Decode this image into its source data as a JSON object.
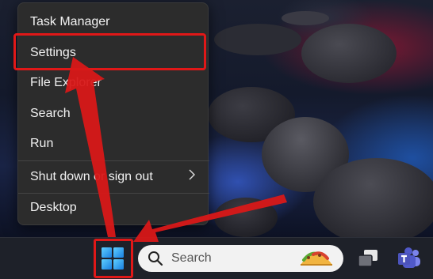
{
  "menu": {
    "items": [
      {
        "label": "Task Manager"
      },
      {
        "label": "Settings"
      },
      {
        "label": "File Explorer"
      },
      {
        "label": "Search"
      },
      {
        "label": "Run"
      },
      {
        "label": "Shut down or sign out",
        "has_submenu": true
      },
      {
        "label": "Desktop"
      }
    ],
    "submenu_icon": "chevron-right-icon",
    "highlighted_item": "Settings"
  },
  "taskbar": {
    "search_placeholder": "Search",
    "start_icon": "windows-logo-icon",
    "icons": [
      "search-icon",
      "taco-widget-icon",
      "task-view-icon",
      "teams-icon"
    ]
  },
  "annotation": {
    "color": "#e01818"
  }
}
